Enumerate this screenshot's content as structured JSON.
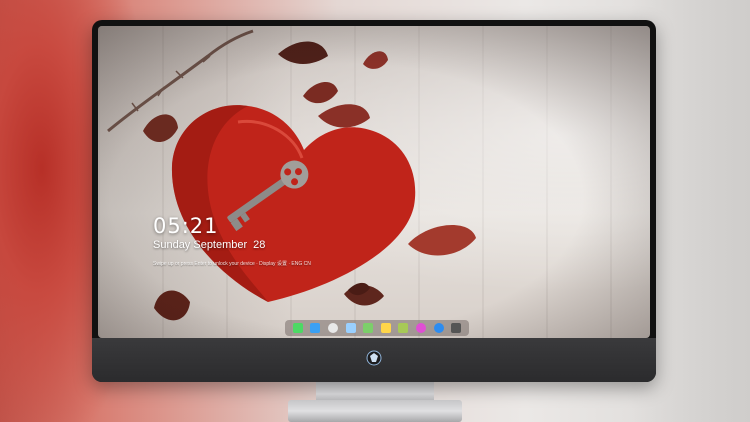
{
  "lock_screen": {
    "time": "05:21",
    "date_weekday_month": "Sunday September",
    "date_day": "28",
    "hint_text": "Swipe up or press Enter to unlock your device  ·  Display 设置  ·  ENG CN"
  },
  "dock": {
    "icons": [
      {
        "name": "messages-icon",
        "color": "#4cd964"
      },
      {
        "name": "finder-icon",
        "color": "#3aa0f3"
      },
      {
        "name": "safari-icon",
        "color": "#e8e8e8"
      },
      {
        "name": "photos-icon",
        "color": "#9ad0ff"
      },
      {
        "name": "maps-icon",
        "color": "#7ccf6a"
      },
      {
        "name": "notes-icon",
        "color": "#ffd64a"
      },
      {
        "name": "preview-icon",
        "color": "#a7c957"
      },
      {
        "name": "itunes-icon",
        "color": "#e04fd4"
      },
      {
        "name": "app-store-icon",
        "color": "#2d8cf0"
      },
      {
        "name": "camera-icon",
        "color": "#555555"
      }
    ]
  },
  "colors": {
    "heart": "#c0241a",
    "leaf": "#7a2b22"
  }
}
